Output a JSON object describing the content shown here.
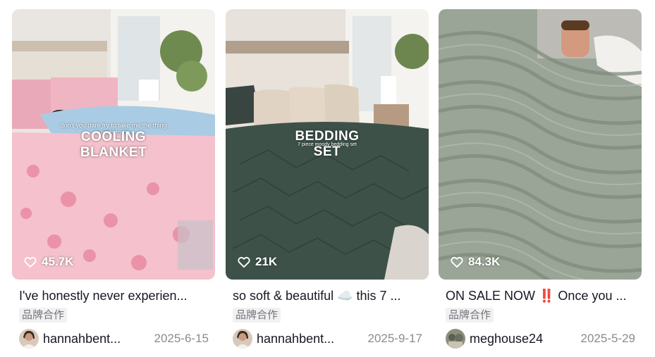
{
  "cards": [
    {
      "likes": "45.7K",
      "overlay_small": "don't you dare try to take me the thing needs to be",
      "overlay_big": "COOLING BLANKET",
      "title": "I've honestly never experien...",
      "badge": "品牌合作",
      "username": "hannahbent...",
      "date": "2025-6-15"
    },
    {
      "likes": "21K",
      "overlay_small": "7 piece moody bedding set",
      "overlay_big": "BEDDING SET",
      "title": "so soft & beautiful ☁️ this 7 ...",
      "badge": "品牌合作",
      "username": "hannahbent...",
      "date": "2025-9-17"
    },
    {
      "likes": "84.3K",
      "title": "ON SALE NOW ‼️ Once you ...",
      "badge": "品牌合作",
      "username": "meghouse24",
      "date": "2025-5-29"
    }
  ],
  "icons": {
    "likes": "heart-outline-icon"
  },
  "colors": {
    "text": "#161823",
    "muted": "#8a8b91",
    "badge_bg": "#f1f1f2",
    "badge_text": "#73747b"
  }
}
